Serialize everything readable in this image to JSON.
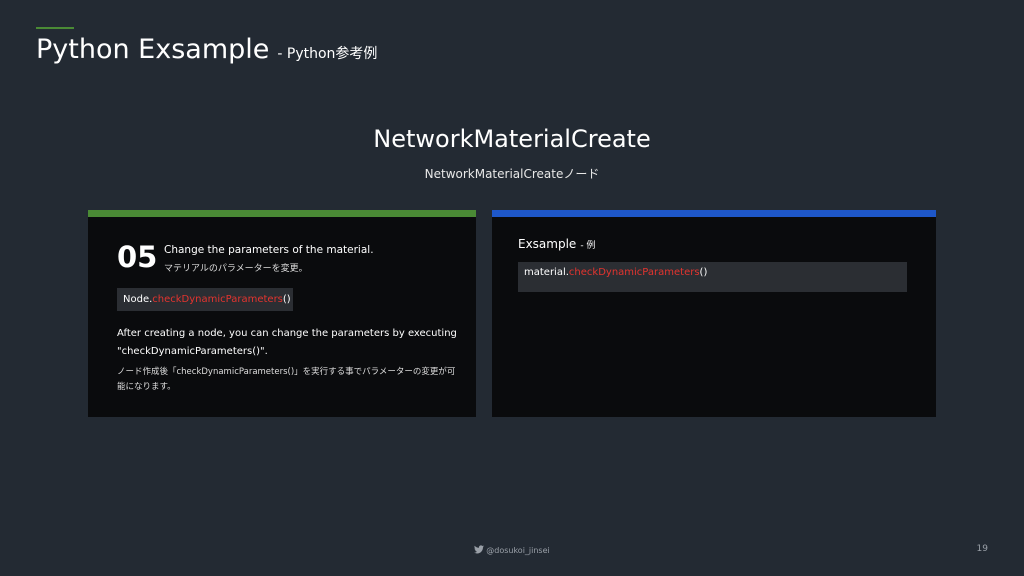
{
  "header": {
    "title": "Python Exsample",
    "subtitle": "- Python参考例"
  },
  "section": {
    "title": "NetworkMaterialCreate",
    "subtitle": "NetworkMaterialCreateノード"
  },
  "left_panel": {
    "bar_color": "#4a8a35",
    "step_number": "05",
    "step_en": "Change the parameters of the material.",
    "step_jp": "マテリアルのパラメーターを変更。",
    "code": {
      "prefix": "Node.",
      "method": "checkDynamicParameters",
      "suffix": "()"
    },
    "description_en": "After creating a node, you can change the parameters by executing \"checkDynamicParameters()\".",
    "description_jp": "ノード作成後「checkDynamicParameters()」を実行する事でパラメーターの変更が可能になります。"
  },
  "right_panel": {
    "bar_color": "#1e57c9",
    "title": "Exsample",
    "title_sub": "- 例",
    "code": {
      "prefix": "material.",
      "method": "checkDynamicParameters",
      "suffix": "()"
    }
  },
  "footer": {
    "handle": "@dosukoi_jinsei",
    "page_number": "19",
    "icon": "twitter-bird-icon"
  },
  "colors": {
    "background": "#232a33",
    "panel": "#0a0b0d",
    "code_bg": "#2b2e33",
    "code_highlight": "#e3342f"
  }
}
